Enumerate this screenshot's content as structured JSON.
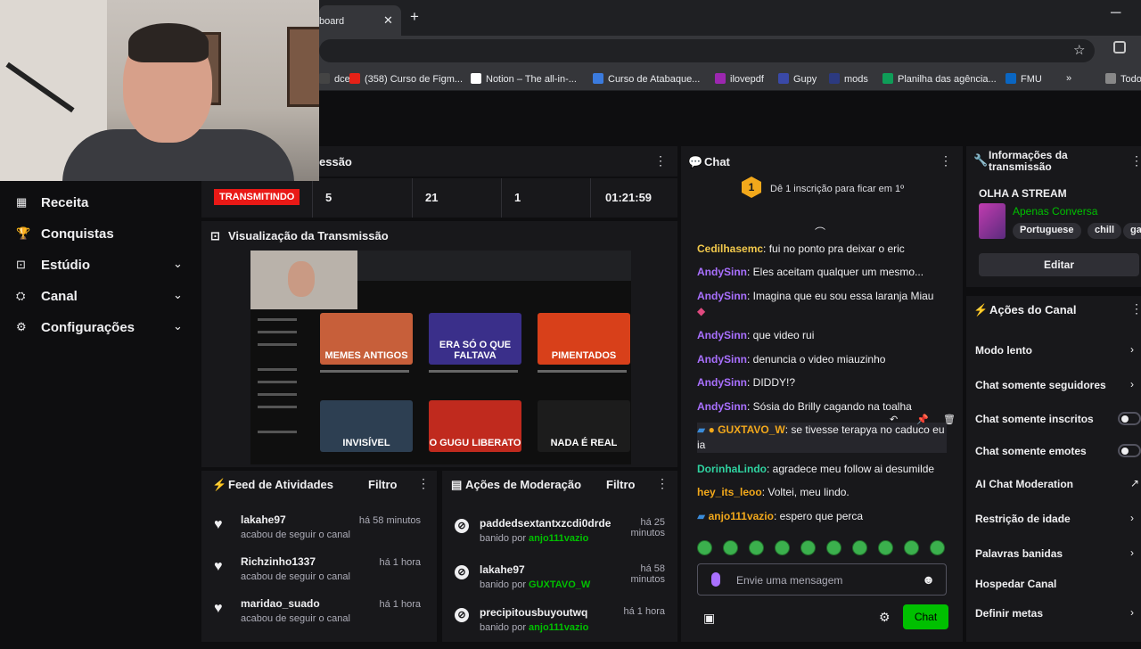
{
  "browser": {
    "tab_title": "board",
    "bookmarks": [
      {
        "label": "dcel",
        "color": "#444444"
      },
      {
        "label": "(358) Curso de Figm...",
        "color": "#e62117"
      },
      {
        "label": "Notion – The all-in-...",
        "color": "#ffffff"
      },
      {
        "label": "Curso de Atabaque...",
        "color": "#3b7bde"
      },
      {
        "label": "ilovepdf",
        "color": "#9c27b0"
      },
      {
        "label": "Gupy",
        "color": "#3a49a8"
      },
      {
        "label": "mods",
        "color": "#2c3a80"
      },
      {
        "label": "Planilha das agência...",
        "color": "#0f9d58"
      },
      {
        "label": "FMU",
        "color": "#0a66c2"
      },
      {
        "label": "Todo",
        "color": "#888888"
      }
    ]
  },
  "sidebar": {
    "items": [
      {
        "label": "Receita",
        "icon": "▦"
      },
      {
        "label": "Conquistas",
        "icon": "🏆"
      },
      {
        "label": "Estúdio",
        "icon": "⊡",
        "chevron": "⌄"
      },
      {
        "label": "Canal",
        "icon": "⛭",
        "chevron": "⌄"
      },
      {
        "label": "Configurações",
        "icon": "⚙",
        "chevron": "⌄"
      }
    ]
  },
  "session": {
    "title": "essão",
    "status": "TRANSMITINDO",
    "stats": [
      "5",
      "21",
      "1",
      "01:21:59"
    ]
  },
  "preview": {
    "title": "Visualização da Transmissão",
    "thumbs": [
      {
        "label": "MEMES ANTIGOS",
        "color": "#c75f3a"
      },
      {
        "label": "ERA SÓ O QUE FALTAVA",
        "color": "#3a2f8a"
      },
      {
        "label": "",
        "color": "#2b2b2b"
      },
      {
        "label": "PIMENTADOS",
        "color": "#d8401a"
      },
      {
        "label": "INVISÍVEL",
        "color": "#2d3f52"
      },
      {
        "label": "O GUGU LIBERATO",
        "color": "#c02a1e"
      },
      {
        "label": "NADA É REAL",
        "color": "#1c1c1c"
      }
    ]
  },
  "feed": {
    "title": "Feed de Atividades",
    "filter": "Filtro",
    "items": [
      {
        "name": "lakahe97",
        "action": "acabou de seguir o canal",
        "time": "há 58 minutos"
      },
      {
        "name": "Richzinho1337",
        "action": "acabou de seguir o canal",
        "time": "há 1 hora"
      },
      {
        "name": "maridao_suado",
        "action": "acabou de seguir o canal",
        "time": "há 1 hora"
      }
    ]
  },
  "moderation": {
    "title": "Ações de Moderação",
    "filter": "Filtro",
    "items": [
      {
        "name": "paddedsextantxzcdi0drde",
        "action": "banido por ",
        "by": "anjo111vazio",
        "time": "há 25 minutos"
      },
      {
        "name": "lakahe97",
        "action": "banido por ",
        "by": "GUXTAVO_W",
        "time": "há 58 minutos"
      },
      {
        "name": "precipitousbuyoutwq",
        "action": "banido por ",
        "by": "anjo111vazio",
        "time": "há 1 hora"
      }
    ]
  },
  "chat": {
    "title": "Chat",
    "banner_badge": "1",
    "banner": "Dê 1 inscrição para ficar em 1º",
    "messages": [
      {
        "user": "Cedilhasemc",
        "color": "#f2c94c",
        "text": "fui no ponto pra deixar o eric"
      },
      {
        "user": "AndySinn",
        "color": "#a970ff",
        "text": "Eles aceitam qualquer um mesmo..."
      },
      {
        "user": "AndySinn",
        "color": "#a970ff",
        "text": "Imagina que eu sou essa laranja Miau"
      },
      {
        "user": "AndySinn",
        "color": "#a970ff",
        "text": "que video rui"
      },
      {
        "user": "AndySinn",
        "color": "#a970ff",
        "text": "denuncia o video miauzinho"
      },
      {
        "user": "AndySinn",
        "color": "#a970ff",
        "text": "DIDDY!?"
      },
      {
        "user": "AndySinn",
        "color": "#a970ff",
        "text": "Sósia do Brilly cagando na toalha"
      },
      {
        "user": "GUXTAVO_W",
        "color": "#f2a81b",
        "text": "se tivesse terapya no caduco eu ia"
      },
      {
        "user": "DorinhaLindo",
        "color": "#2fd2a0",
        "text": "agradece meu follow ai desumilde"
      },
      {
        "user": "hey_its_leoo",
        "color": "#f2a81b",
        "text": "Voltei, meu lindo."
      },
      {
        "user": "anjo111vazio",
        "color": "#f2a81b",
        "text": "espero que perca"
      }
    ],
    "input_placeholder": "Envie uma mensagem",
    "send_label": "Chat"
  },
  "info": {
    "title": "Informações da transmissão",
    "stream_title": "OLHA A STREAM",
    "category": "Apenas Conversa",
    "tags": [
      "Portuguese",
      "chill",
      "gar"
    ],
    "edit_label": "Editar"
  },
  "actions": {
    "title": "Ações do Canal",
    "items": [
      {
        "label": "Modo lento",
        "kind": "chevron"
      },
      {
        "label": "Chat somente seguidores",
        "kind": "chevron"
      },
      {
        "label": "Chat somente inscritos",
        "kind": "toggle"
      },
      {
        "label": "Chat somente emotes",
        "kind": "toggle"
      },
      {
        "label": "AI Chat Moderation",
        "kind": "external"
      },
      {
        "label": "Restrição de idade",
        "kind": "chevron"
      },
      {
        "label": "Palavras banidas",
        "kind": "chevron"
      },
      {
        "label": "Hospedar Canal",
        "kind": "none"
      },
      {
        "label": "Definir metas",
        "kind": "chevron"
      }
    ]
  },
  "colors": {
    "accent": "#00c000",
    "live": "#e91916",
    "panel": "#18181b",
    "bg": "#0e0e10"
  }
}
